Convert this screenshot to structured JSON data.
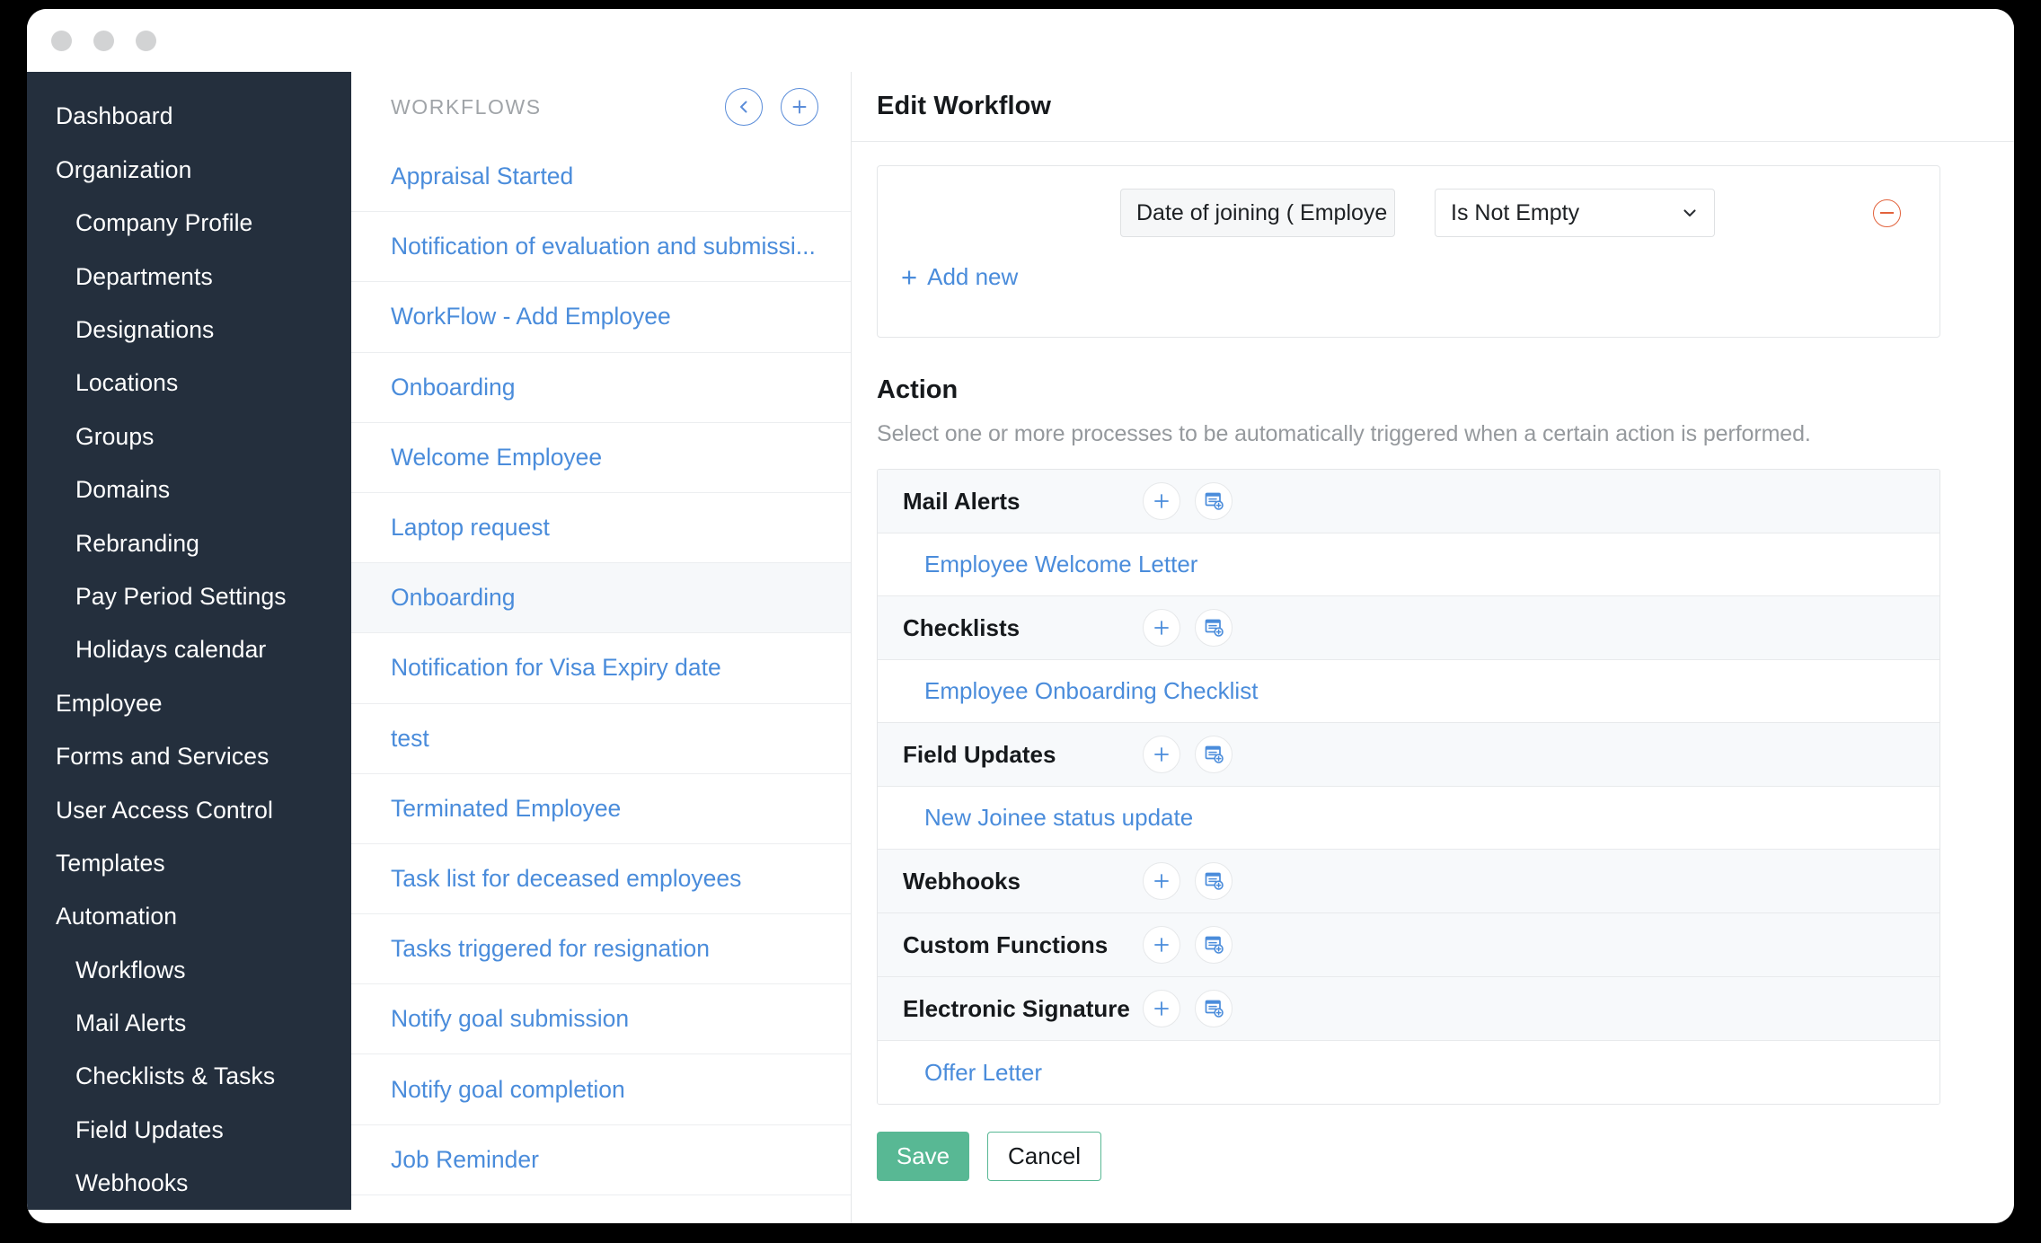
{
  "window": {
    "dots": [
      "dot-1",
      "dot-2",
      "dot-3"
    ]
  },
  "sidebar": {
    "items": [
      {
        "label": "Dashboard",
        "level": 1
      },
      {
        "label": "Organization",
        "level": 1
      },
      {
        "label": "Company Profile",
        "level": 2
      },
      {
        "label": "Departments",
        "level": 2
      },
      {
        "label": "Designations",
        "level": 2
      },
      {
        "label": "Locations",
        "level": 2
      },
      {
        "label": "Groups",
        "level": 2
      },
      {
        "label": "Domains",
        "level": 2
      },
      {
        "label": "Rebranding",
        "level": 2
      },
      {
        "label": "Pay Period Settings",
        "level": 2
      },
      {
        "label": "Holidays calendar",
        "level": 2
      },
      {
        "label": "Employee",
        "level": 1
      },
      {
        "label": "Forms and Services",
        "level": 1
      },
      {
        "label": "User Access Control",
        "level": 1
      },
      {
        "label": "Templates",
        "level": 1
      },
      {
        "label": "Automation",
        "level": 1
      },
      {
        "label": "Workflows",
        "level": 2
      },
      {
        "label": "Mail Alerts",
        "level": 2
      },
      {
        "label": "Checklists & Tasks",
        "level": 2
      },
      {
        "label": "Field Updates",
        "level": 2
      },
      {
        "label": "Webhooks",
        "level": 2
      }
    ]
  },
  "workflows_panel": {
    "title": "WORKFLOWS",
    "collapse_icon": "chevron-left-icon",
    "add_icon": "plus-icon",
    "items": [
      {
        "label": "Appraisal Started",
        "selected": false
      },
      {
        "label": "Notification of evaluation and submissi...",
        "selected": false
      },
      {
        "label": "WorkFlow - Add Employee",
        "selected": false
      },
      {
        "label": "Onboarding",
        "selected": false
      },
      {
        "label": "Welcome Employee",
        "selected": false
      },
      {
        "label": "Laptop request",
        "selected": false
      },
      {
        "label": "Onboarding",
        "selected": true
      },
      {
        "label": "Notification for Visa Expiry date",
        "selected": false
      },
      {
        "label": "test",
        "selected": false
      },
      {
        "label": "Terminated Employee",
        "selected": false
      },
      {
        "label": "Task list for deceased employees",
        "selected": false
      },
      {
        "label": "Tasks triggered for resignation",
        "selected": false
      },
      {
        "label": "Notify goal submission",
        "selected": false
      },
      {
        "label": "Notify goal completion",
        "selected": false
      },
      {
        "label": "Job Reminder",
        "selected": false
      }
    ]
  },
  "editor": {
    "title": "Edit Workflow",
    "criteria": {
      "field_value": "Date of joining ( Employe",
      "operator_value": "Is Not Empty",
      "remove_icon": "minus-circle-icon",
      "dropdown_icon": "chevron-down-icon",
      "add_new_label": "Add new",
      "add_new_icon": "plus-icon"
    },
    "action": {
      "heading": "Action",
      "description": "Select one or more processes to be automatically triggered when a certain action is performed.",
      "groups": [
        {
          "label": "Mail Alerts",
          "add_icon": "plus-icon",
          "create_icon": "document-add-icon",
          "items": [
            "Employee Welcome Letter"
          ]
        },
        {
          "label": "Checklists",
          "add_icon": "plus-icon",
          "create_icon": "document-add-icon",
          "items": [
            "Employee Onboarding Checklist"
          ]
        },
        {
          "label": "Field Updates",
          "add_icon": "plus-icon",
          "create_icon": "document-add-icon",
          "items": [
            "New Joinee status update"
          ]
        },
        {
          "label": "Webhooks",
          "add_icon": "plus-icon",
          "create_icon": "document-add-icon",
          "items": []
        },
        {
          "label": "Custom Functions",
          "add_icon": "plus-icon",
          "create_icon": "document-add-icon",
          "items": []
        },
        {
          "label": "Electronic Signature",
          "add_icon": "plus-icon",
          "create_icon": "document-add-icon",
          "items": [
            "Offer Letter"
          ]
        }
      ]
    },
    "save_label": "Save",
    "cancel_label": "Cancel"
  },
  "colors": {
    "sidebar_bg": "#242f3d",
    "link_blue": "#4a8cdb",
    "save_green": "#58b894",
    "remove_red": "#e2623c",
    "row_selected": "#f6f8fa"
  }
}
